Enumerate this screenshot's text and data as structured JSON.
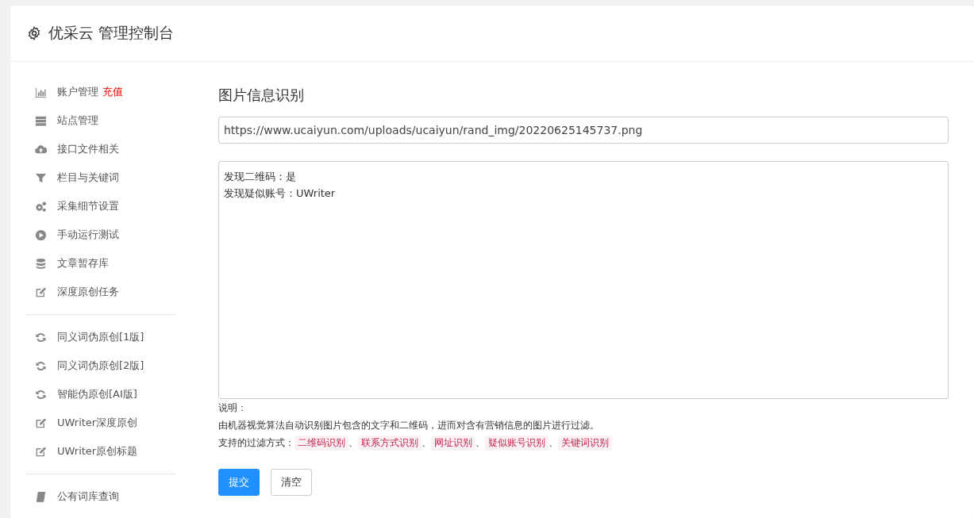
{
  "header": {
    "title": "优采云 管理控制台"
  },
  "sidebar": {
    "groups": [
      {
        "items": [
          {
            "label": "账户管理",
            "badge": "充值"
          },
          {
            "label": "站点管理"
          },
          {
            "label": "接口文件相关"
          },
          {
            "label": "栏目与关键词"
          },
          {
            "label": "采集细节设置"
          },
          {
            "label": "手动运行测试"
          },
          {
            "label": "文章暂存库"
          },
          {
            "label": "深度原创任务"
          }
        ]
      },
      {
        "items": [
          {
            "label": "同义词伪原创[1版]"
          },
          {
            "label": "同义词伪原创[2版]"
          },
          {
            "label": "智能伪原创[AI版]"
          },
          {
            "label": "UWriter深度原创"
          },
          {
            "label": "UWriter原创标题"
          }
        ]
      },
      {
        "items": [
          {
            "label": "公有词库查询"
          }
        ]
      }
    ]
  },
  "main": {
    "title": "图片信息识别",
    "url_field": {
      "value": "https://www.ucaiyun.com/uploads/ucaiyun/rand_img/20220625145737.png"
    },
    "result_area": {
      "lines": [
        "发现二维码：是",
        "发现疑似账号：UWriter"
      ]
    },
    "notes_label": "说明：",
    "description": "由机器视觉算法自动识别图片包含的文字和二维码，进而对含有营销信息的图片进行过滤。",
    "methods_label": "支持的过滤方式：",
    "methods": [
      "二维码识别",
      "联系方式识别",
      "网址识别",
      "疑似账号识别",
      "关键词识别"
    ],
    "separator": "、",
    "buttons": [
      {
        "label": "提交",
        "kind": "primary"
      },
      {
        "label": "清空",
        "kind": "default"
      }
    ]
  }
}
